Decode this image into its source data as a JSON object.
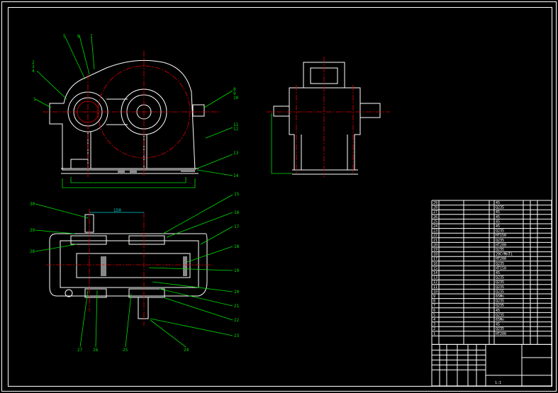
{
  "drawing": {
    "front_view_labels": [
      "1",
      "2",
      "3",
      "4",
      "5",
      "6",
      "7",
      "8",
      "9",
      "10",
      "11",
      "12",
      "13",
      "14"
    ],
    "plan_view_labels": [
      "30",
      "29",
      "28",
      "15",
      "16",
      "17",
      "18",
      "19",
      "20",
      "21",
      "22",
      "23",
      "24",
      "25",
      "26",
      "27"
    ],
    "center_distance_dim": "150",
    "colors": {
      "background": "#000000",
      "outline": "#ffffff",
      "centerline": "#e00000",
      "leader": "#00e000",
      "dimension": "#00d0d0"
    }
  },
  "parts_table": {
    "rows": [
      {
        "no": "29",
        "material": "45"
      },
      {
        "no": "28",
        "material": "Q235"
      },
      {
        "no": "27",
        "material": "45"
      },
      {
        "no": "26",
        "material": "45"
      },
      {
        "no": "25",
        "material": "45"
      },
      {
        "no": "24",
        "material": "45"
      },
      {
        "no": "23",
        "material": "Q235"
      },
      {
        "no": "22",
        "material": "HT150"
      },
      {
        "no": "21",
        "material": "Q235"
      },
      {
        "no": "20",
        "material": "HT200"
      },
      {
        "no": "19",
        "material": "Q235"
      },
      {
        "no": "18",
        "material": "20CrMnTi"
      },
      {
        "no": "17",
        "material": "HT200"
      },
      {
        "no": "16",
        "material": "Q235"
      },
      {
        "no": "15",
        "material": "HT150"
      },
      {
        "no": "14",
        "material": "45"
      },
      {
        "no": "13",
        "material": "Q235"
      },
      {
        "no": "12",
        "material": "Q235"
      },
      {
        "no": "11",
        "material": "Q235"
      },
      {
        "no": "10",
        "material": "Q235"
      },
      {
        "no": "9",
        "material": "65Mn"
      },
      {
        "no": "8",
        "material": "Q235"
      },
      {
        "no": "7",
        "material": "Q235"
      },
      {
        "no": "6",
        "material": "45"
      },
      {
        "no": "5",
        "material": "Q235"
      },
      {
        "no": "4",
        "material": "65Mn"
      },
      {
        "no": "3",
        "material": "45"
      },
      {
        "no": "2",
        "material": "Q235"
      },
      {
        "no": "1",
        "material": "HT200"
      }
    ],
    "title_block": {
      "scale": "1:1"
    }
  }
}
